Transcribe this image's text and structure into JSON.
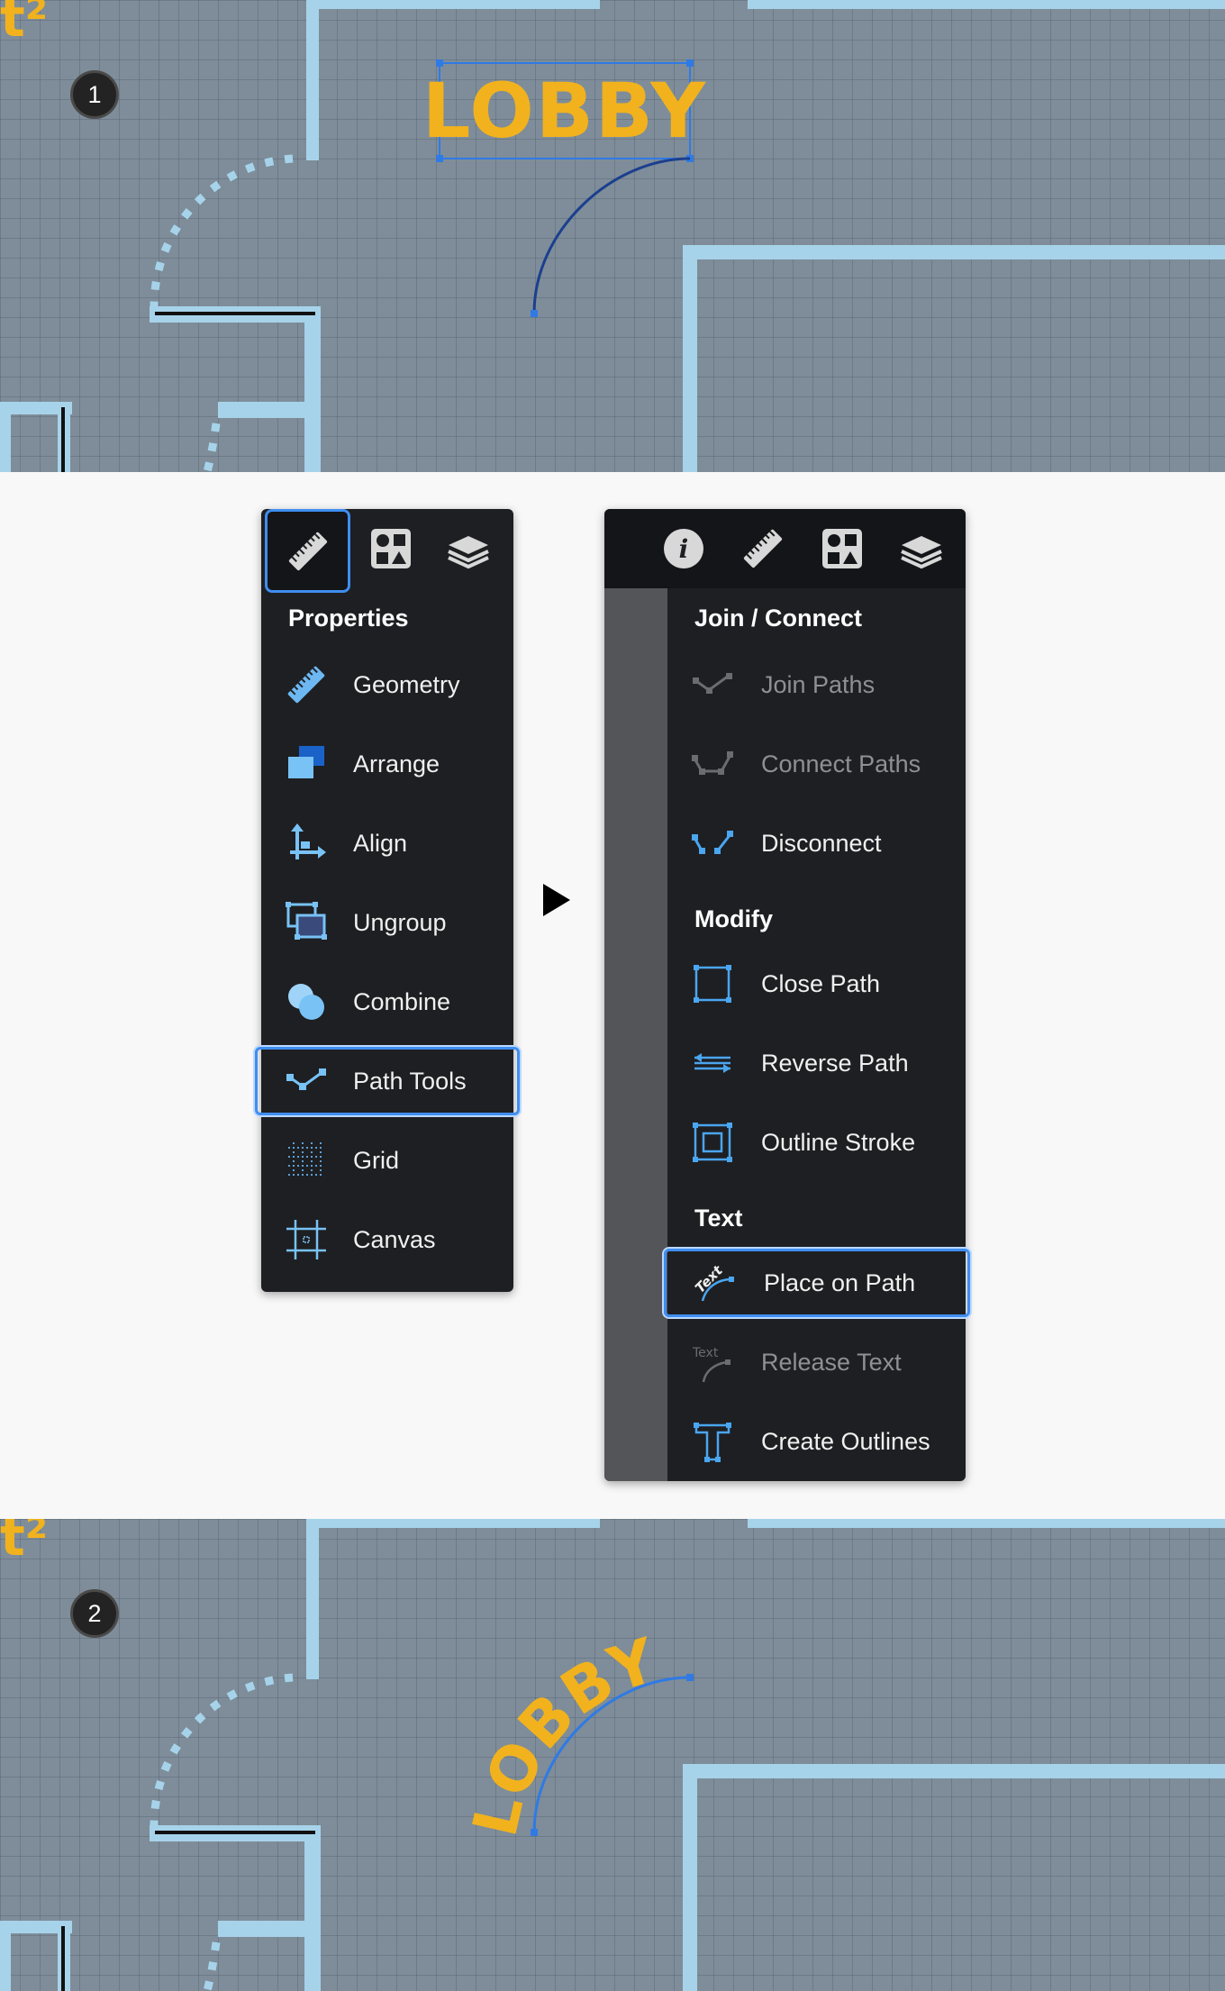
{
  "steps": {
    "first": "1",
    "second": "2"
  },
  "canvas": {
    "label_text": "LOBBY",
    "corner_glyph": "t²",
    "colors": {
      "background": "#7e8d99",
      "walls": "#a6d3ea",
      "text": "#f2b21d",
      "selection": "#2f7ae5"
    }
  },
  "left_menu": {
    "tabs": [
      "ruler-icon",
      "shapes-icon",
      "layers-icon"
    ],
    "section_title": "Properties",
    "items": [
      {
        "label": "Geometry",
        "icon": "geometry-ruler-icon",
        "state": "normal"
      },
      {
        "label": "Arrange",
        "icon": "arrange-icon",
        "state": "normal"
      },
      {
        "label": "Align",
        "icon": "align-icon",
        "state": "normal"
      },
      {
        "label": "Ungroup",
        "icon": "ungroup-icon",
        "state": "normal"
      },
      {
        "label": "Combine",
        "icon": "combine-icon",
        "state": "normal"
      },
      {
        "label": "Path Tools",
        "icon": "path-tools-icon",
        "state": "selected"
      },
      {
        "label": "Grid",
        "icon": "grid-icon",
        "state": "normal"
      },
      {
        "label": "Canvas",
        "icon": "canvas-icon",
        "state": "normal"
      }
    ]
  },
  "right_menu": {
    "tabs": [
      "info-icon",
      "ruler-icon",
      "shapes-icon",
      "layers-icon"
    ],
    "sections": [
      {
        "title": "Join / Connect",
        "items": [
          {
            "label": "Join Paths",
            "icon": "join-paths-icon",
            "state": "disabled"
          },
          {
            "label": "Connect Paths",
            "icon": "connect-paths-icon",
            "state": "disabled"
          },
          {
            "label": "Disconnect",
            "icon": "disconnect-icon",
            "state": "normal"
          }
        ]
      },
      {
        "title": "Modify",
        "items": [
          {
            "label": "Close Path",
            "icon": "close-path-icon",
            "state": "normal"
          },
          {
            "label": "Reverse Path",
            "icon": "reverse-path-icon",
            "state": "normal"
          },
          {
            "label": "Outline Stroke",
            "icon": "outline-stroke-icon",
            "state": "normal"
          }
        ]
      },
      {
        "title": "Text",
        "items": [
          {
            "label": "Place on Path",
            "icon": "place-on-path-icon",
            "state": "selected"
          },
          {
            "label": "Release Text",
            "icon": "release-text-icon",
            "state": "disabled"
          },
          {
            "label": "Create Outlines",
            "icon": "create-outlines-icon",
            "state": "normal"
          }
        ]
      }
    ]
  }
}
